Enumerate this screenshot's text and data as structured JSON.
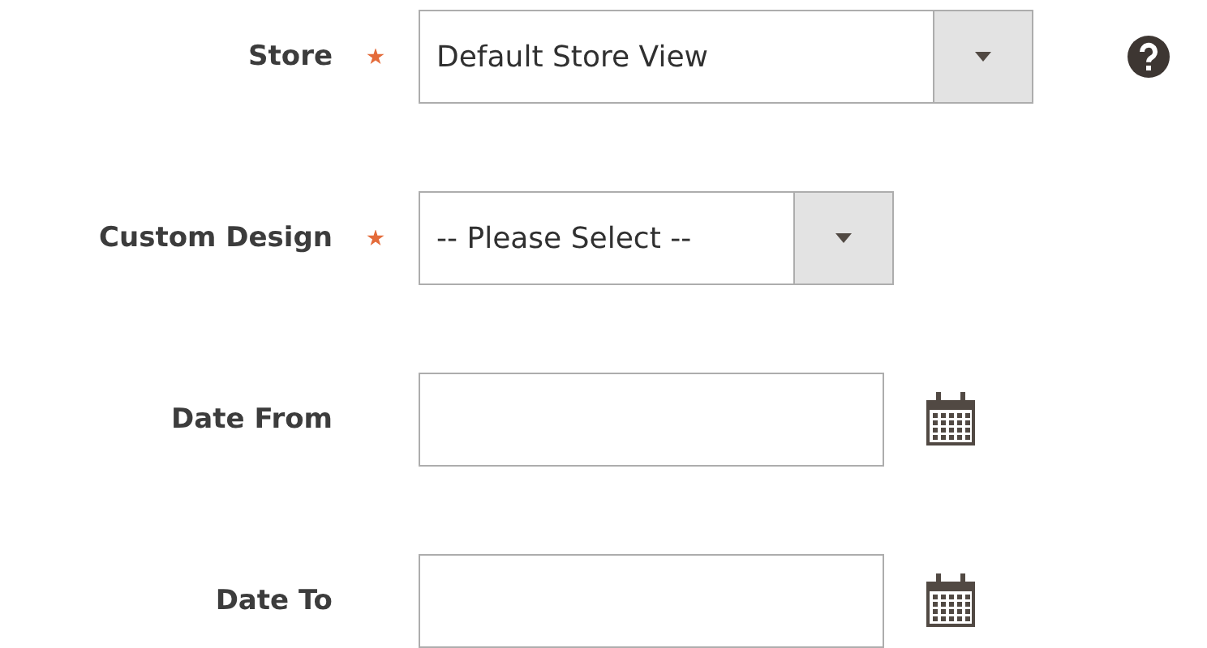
{
  "fields": [
    {
      "kind": "select",
      "label": "Store",
      "required": true,
      "value": "Default Store View",
      "help": true
    },
    {
      "kind": "select",
      "label": "Custom Design",
      "required": true,
      "value": "-- Please Select --",
      "help": false
    },
    {
      "kind": "date",
      "label": "Date From",
      "required": false,
      "help": false
    },
    {
      "kind": "date",
      "label": "Date To",
      "required": false,
      "help": false
    }
  ]
}
